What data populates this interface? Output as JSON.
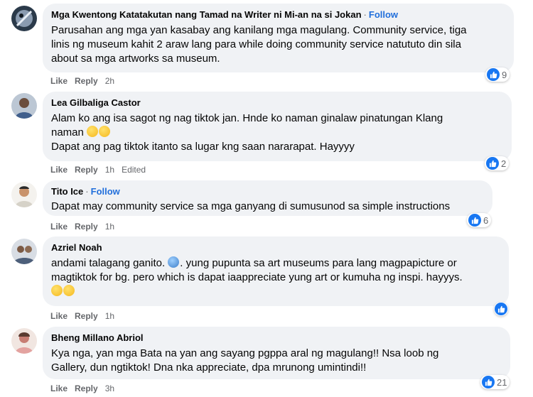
{
  "comments": [
    {
      "author": "Mga Kwentong Katatakutan nang Tamad na Writer ni Mi-an na si Jokan",
      "follow": "Follow",
      "text_lines": [
        "Parusahan ang mga yan kasabay ang kanilang mga magulang. Community service, tiga",
        "linis ng museum kahit 2 araw lang para while doing community service natututo din sila",
        "about sa mga artworks sa museum."
      ],
      "like": "Like",
      "reply": "Reply",
      "time": "2h",
      "reaction_count": "9"
    },
    {
      "author": "Lea Gilbaliga Castor",
      "text_lines": [
        "Alam ko ang isa sagot ng nag tiktok jan. Hnde ko naman ginalaw pinatungan Klang",
        "naman",
        "Dapat ang pag tiktok itanto sa lugar kng saan nararapat. Hayyyy"
      ],
      "like": "Like",
      "reply": "Reply",
      "time": "1h",
      "edited": "Edited",
      "reaction_count": "2"
    },
    {
      "author": "Tito Ice",
      "follow": "Follow",
      "text_lines": [
        "Dapat may community service sa mga ganyang di sumusunod sa simple instructions"
      ],
      "like": "Like",
      "reply": "Reply",
      "time": "1h",
      "reaction_count": "6"
    },
    {
      "author": "Azriel Noah",
      "text_lines": [
        "andami talagang ganito.",
        ". yung pupunta sa art museums para lang magpapicture or",
        "magtiktok for bg. pero which is dapat iaappreciate yung art or kumuha ng inspi. hayyys."
      ],
      "like": "Like",
      "reply": "Reply",
      "time": "1h",
      "reaction_count": ""
    },
    {
      "author": "Bheng Millano Abriol",
      "text_lines": [
        "Kya nga, yan mga Bata na yan ang sayang pgppa aral ng magulang!! Nsa loob ng",
        "Gallery, dun ngtiktok! Dna nka appreciate, dpa mrunong umintindi!!"
      ],
      "like": "Like",
      "reply": "Reply",
      "time": "3h",
      "reaction_count": "21"
    }
  ],
  "colors": {
    "bubble": "#f0f2f5",
    "follow": "#216fdb",
    "like_icon": "#1877f2",
    "meta": "#65676b"
  }
}
